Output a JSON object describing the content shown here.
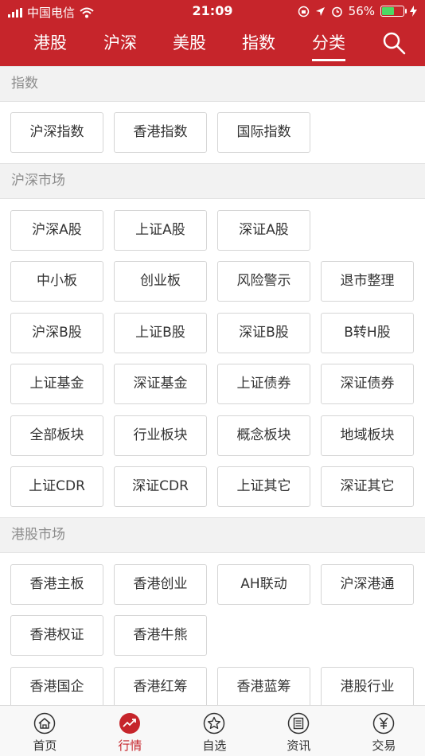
{
  "status_bar": {
    "carrier": "中国电信",
    "time": "21:09",
    "battery": "56%"
  },
  "top_tabs": [
    {
      "label": "港股"
    },
    {
      "label": "沪深"
    },
    {
      "label": "美股"
    },
    {
      "label": "指数"
    },
    {
      "label": "分类",
      "active": true
    }
  ],
  "icons": {
    "search": "search-icon",
    "wifi": "wifi-icon",
    "location": "location-icon",
    "alarm": "alarm-icon",
    "lock_rotation": "lock-rotation-icon",
    "charging": "charging-icon"
  },
  "sections": {
    "index": {
      "title": "指数",
      "items": [
        "沪深指数",
        "香港指数",
        "国际指数"
      ]
    },
    "hs_market": {
      "title": "沪深市场",
      "items": [
        "沪深A股",
        "上证A股",
        "深证A股",
        "中小板",
        "创业板",
        "风险警示",
        "退市整理",
        "沪深B股",
        "上证B股",
        "深证B股",
        "B转H股",
        "上证基金",
        "深证基金",
        "上证债券",
        "深证债券",
        "全部板块",
        "行业板块",
        "概念板块",
        "地域板块",
        "上证CDR",
        "深证CDR",
        "上证其它",
        "深证其它"
      ]
    },
    "hk_market": {
      "title": "港股市场",
      "items": [
        "香港主板",
        "香港创业",
        "AH联动",
        "沪深港通",
        "香港权证",
        "香港牛熊",
        "香港国企",
        "香港红筹",
        "香港蓝筹",
        "港股行业"
      ]
    }
  },
  "bottom_nav": [
    {
      "label": "首页",
      "icon": "home-icon"
    },
    {
      "label": "行情",
      "icon": "market-trend-icon",
      "active": true
    },
    {
      "label": "自选",
      "icon": "star-icon"
    },
    {
      "label": "资讯",
      "icon": "news-icon"
    },
    {
      "label": "交易",
      "icon": "yen-trade-icon"
    }
  ],
  "colors": {
    "brand_red": "#c6252b",
    "section_bg": "#f2f2f2",
    "section_text": "#8c8c8c",
    "button_border": "#d5d5d5",
    "battery_green": "#4cd964"
  }
}
